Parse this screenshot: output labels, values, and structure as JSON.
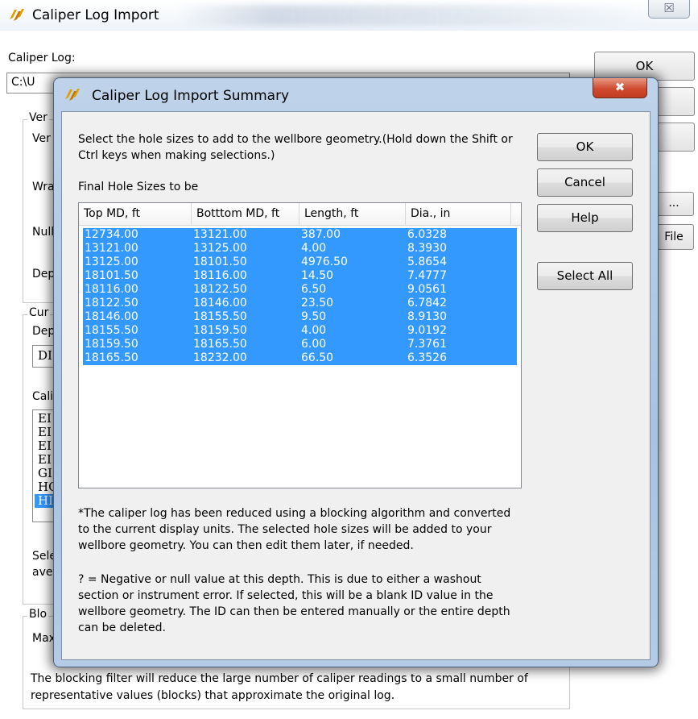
{
  "main": {
    "title": "Caliper Log Import",
    "close_glyph": "☒",
    "caliper_log_label": "Caliper Log:",
    "path_value": "C:\\U",
    "ok_label": "OK",
    "partial_labels": {
      "ver_group": "Ver",
      "ver": "Ver",
      "wra": "Wra",
      "null": "Null",
      "dep": "Dep",
      "cur_group": "Cur",
      "dep2": "Dep",
      "cali": "Cali",
      "sel": "Sele",
      "ave": "ave",
      "blo_group": "Blo",
      "max": "Max",
      "ellipsis_btn": "...",
      "file_btn": "File"
    },
    "depth_combo_value": "DI",
    "curve_list_items": [
      "EI",
      "EI",
      "EI",
      "EI",
      "GI",
      "HC",
      "HI"
    ],
    "blocking_description": "The blocking filter will reduce the large number of caliper readings to a small number of representative values (blocks) that approximate the original log."
  },
  "dialog": {
    "title": "Caliper Log Import Summary",
    "close_glyph": "✖",
    "instructions": "Select the hole sizes to add to the wellbore geometry.(Hold down the Shift or Ctrl keys when making selections.)",
    "list_label": "Final Hole Sizes to be",
    "columns": [
      "Top MD, ft",
      "Botttom MD, ft",
      "Length, ft",
      "Dia., in"
    ],
    "rows": [
      [
        "12734.00",
        "13121.00",
        "387.00",
        "6.0328"
      ],
      [
        "13121.00",
        "13125.00",
        "4.00",
        "8.3930"
      ],
      [
        "13125.00",
        "18101.50",
        "4976.50",
        "5.8654"
      ],
      [
        "18101.50",
        "18116.00",
        "14.50",
        "7.4777"
      ],
      [
        "18116.00",
        "18122.50",
        "6.50",
        "9.0561"
      ],
      [
        "18122.50",
        "18146.00",
        "23.50",
        "6.7842"
      ],
      [
        "18146.00",
        "18155.50",
        "9.50",
        "8.9130"
      ],
      [
        "18155.50",
        "18159.50",
        "4.00",
        "9.0192"
      ],
      [
        "18159.50",
        "18165.50",
        "6.00",
        "7.3761"
      ],
      [
        "18165.50",
        "18232.00",
        "66.50",
        "6.3526"
      ]
    ],
    "buttons": {
      "ok": "OK",
      "cancel": "Cancel",
      "help": "Help",
      "select_all": "Select All"
    },
    "note1": "*The caliper log has been reduced using a blocking algorithm and converted to the current display units. The selected hole sizes will be added to your wellbore geometry. You can then edit them later, if needed.",
    "note2": "? = Negative or null value at this depth. This is due to either a washout section or instrument error. If selected, this will be a blank ID value in the wellbore geometry. The ID can then be entered manually or the entire depth can be deleted.",
    "selection_color": "#3399ff"
  }
}
